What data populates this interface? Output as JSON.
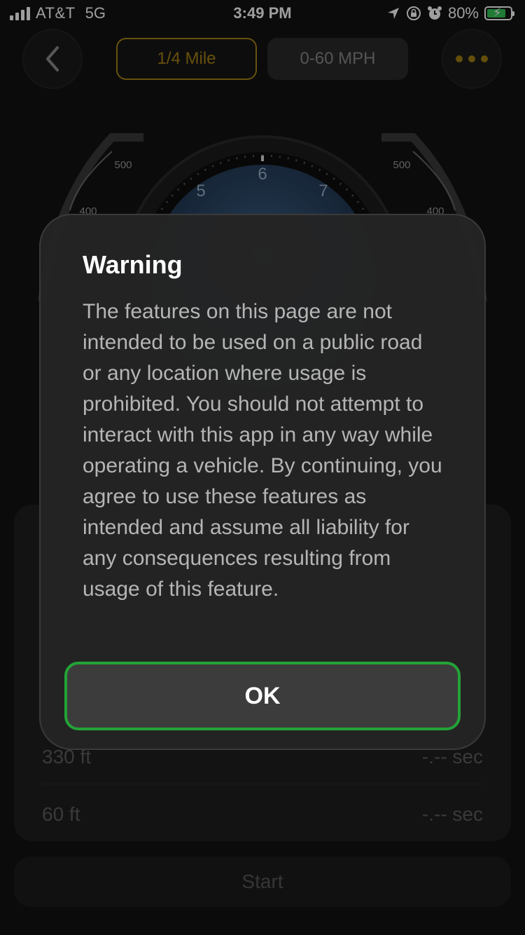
{
  "status_bar": {
    "carrier": "AT&T",
    "network": "5G",
    "time": "3:49 PM",
    "battery": "80%",
    "battery_level": 0.8
  },
  "nav": {
    "tabs": [
      {
        "label": "1/4 Mile",
        "selected": true
      },
      {
        "label": "0-60 MPH",
        "selected": false
      }
    ]
  },
  "gauge": {
    "dial_numbers": [
      "5",
      "6",
      "7"
    ],
    "side_scale_left": [
      "500",
      "400"
    ],
    "side_scale_right": [
      "500",
      "400"
    ]
  },
  "results": {
    "rows": [
      {
        "label": "330 ft",
        "value": "-.-- sec"
      },
      {
        "label": "60 ft",
        "value": "-.-- sec"
      }
    ],
    "start_label": "Start"
  },
  "dialog": {
    "title": "Warning",
    "message": "The features on this page are not intended to be used on a public road or any location where usage is prohibited. You should not attempt to interact with this app in any way while operating a vehicle. By continuing, you agree to use these features as intended and assume all liability for any consequences resulting from usage of this feature.",
    "ok_label": "OK"
  },
  "colors": {
    "accent_gold": "#a78416",
    "ok_border_green": "#23a337",
    "battery_green": "#34c759"
  }
}
